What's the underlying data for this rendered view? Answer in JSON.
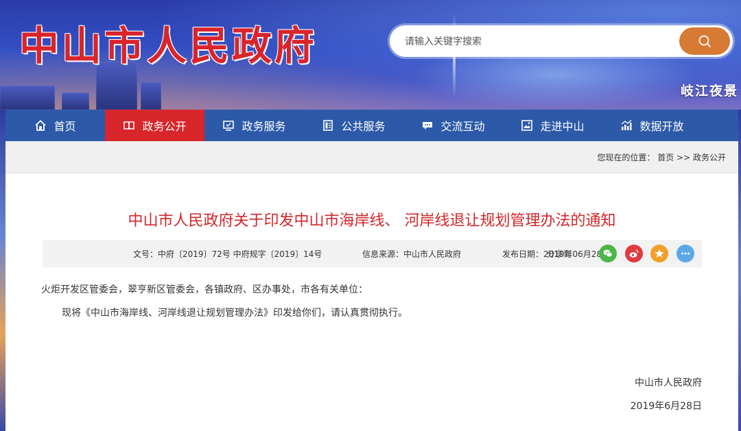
{
  "header": {
    "logo_text": "中山市人民政府",
    "search_placeholder": "请输入关键字搜索",
    "scenic_label": "岐江夜景"
  },
  "nav": {
    "items": [
      {
        "label": "首页",
        "icon": "home-icon"
      },
      {
        "label": "政务公开",
        "icon": "book-icon",
        "active": true
      },
      {
        "label": "政务服务",
        "icon": "monitor-icon"
      },
      {
        "label": "公共服务",
        "icon": "document-icon"
      },
      {
        "label": "交流互动",
        "icon": "chat-icon"
      },
      {
        "label": "走进中山",
        "icon": "picture-icon"
      },
      {
        "label": "数据开放",
        "icon": "bar-chart-icon"
      }
    ]
  },
  "breadcrumb": {
    "prefix": "您现在的位置：",
    "home": "首页",
    "sep": ">>",
    "current": "政务公开"
  },
  "article": {
    "title": "中山市人民政府关于印发中山市海岸线、 河岸线退让规划管理办法的通知",
    "doc_number": "文号：中府〔2019〕72号 中府规字〔2019〕14号",
    "source": "信息来源：中山市人民政府",
    "publish_date": "发布日期：2019年06月28",
    "share_label": "分享到",
    "recipients": "火炬开发区管委会，翠亨新区管委会，各镇政府、区办事处，市各有关单位：",
    "body": "现将《中山市海岸线、河岸线退让规划管理办法》印发给你们，请认真贯彻执行。",
    "signature_org": "中山市人民政府",
    "signature_date": "2019年6月28日"
  },
  "colors": {
    "nav_bg": "#2c5aa8",
    "nav_active": "#d8262b",
    "title_red": "#d1262a",
    "search_btn": "#d67a34",
    "wechat": "#4cb64a",
    "weibo": "#e03a3e",
    "qzone": "#f1a02a",
    "more": "#5aa8e8"
  }
}
